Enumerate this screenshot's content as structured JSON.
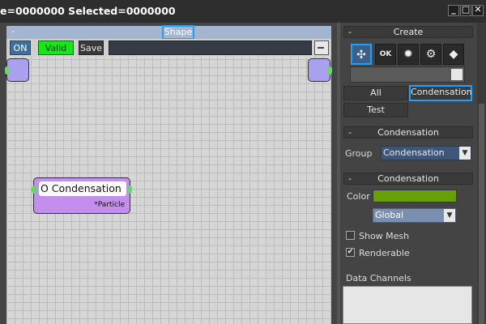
{
  "window": {
    "title": "e=0000000  Selected=0000000",
    "buttons": [
      "_",
      "□",
      "✕"
    ]
  },
  "shape_panel": {
    "collapse": "-",
    "title": "Shape",
    "toolbar": {
      "on_label": "ON",
      "valid_label": "Valid",
      "save_label": "Save"
    }
  },
  "node": {
    "name": "O Condensation",
    "type": "*Particle"
  },
  "create_panel": {
    "collapse": "-",
    "title": "Create",
    "tools": [
      "particle-add-icon",
      "ok-icon",
      "gear-icon",
      "wrench-icon",
      "cube-icon"
    ],
    "buttons": {
      "all": "All",
      "condensation": "Condensation",
      "test": "Test"
    }
  },
  "condensation_panel": {
    "collapse": "-",
    "title": "Condensation",
    "group_label": "Group",
    "group_value": "Condensation"
  },
  "properties_panel": {
    "collapse": "-",
    "title": "Condensation",
    "color_label": "Color",
    "color_value": "#669f09",
    "mode_value": "Global",
    "show_mesh_label": "Show Mesh",
    "show_mesh_checked": false,
    "renderable_label": "Renderable",
    "renderable_checked": true,
    "data_channels_label": "Data Channels"
  },
  "colors": {
    "accent": "#1ea0ff",
    "valid_green": "#19e61a",
    "node_purple": "#c48ef0",
    "port_purple": "#a9a0ef",
    "swatch": "#669f09"
  }
}
